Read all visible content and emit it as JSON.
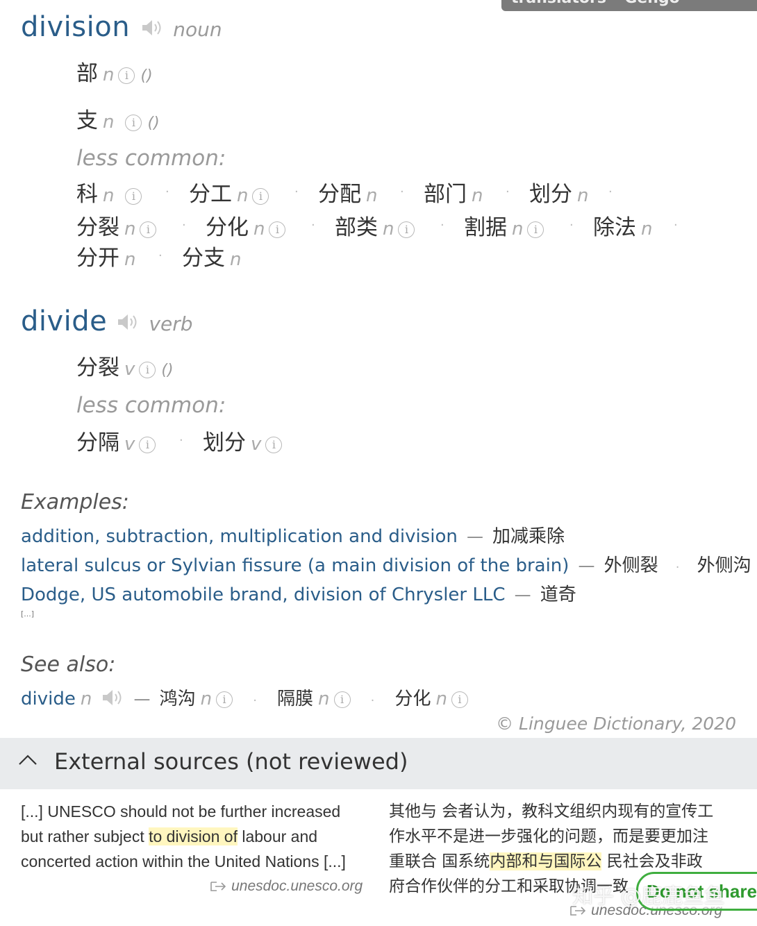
{
  "tooltip": {
    "text": "translators – Gengo"
  },
  "entries": [
    {
      "headword": "division",
      "pos": "noun",
      "main": [
        {
          "zh": "部",
          "g": "n",
          "paren": "()"
        },
        {
          "zh": "支",
          "g": "n",
          "paren": "()"
        }
      ],
      "less_common_label": "less common:",
      "less_common": [
        {
          "zh": "科",
          "g": "n"
        },
        {
          "zh": "分工",
          "g": "n"
        },
        {
          "zh": "分配",
          "g": "n"
        },
        {
          "zh": "部门",
          "g": "n"
        },
        {
          "zh": "划分",
          "g": "n"
        },
        {
          "zh": "分裂",
          "g": "n"
        },
        {
          "zh": "分化",
          "g": "n"
        },
        {
          "zh": "部类",
          "g": "n"
        },
        {
          "zh": "割据",
          "g": "n"
        },
        {
          "zh": "除法",
          "g": "n"
        },
        {
          "zh": "分开",
          "g": "n"
        },
        {
          "zh": "分支",
          "g": "n"
        }
      ]
    },
    {
      "headword": "divide",
      "pos": "verb",
      "main": [
        {
          "zh": "分裂",
          "g": "v",
          "paren": "()"
        }
      ],
      "less_common_label": "less common:",
      "less_common": [
        {
          "zh": "分隔",
          "g": "v"
        },
        {
          "zh": "划分",
          "g": "v"
        }
      ]
    }
  ],
  "examples": {
    "label": "Examples:",
    "items": [
      {
        "en": "addition, subtraction, multiplication and division",
        "zh": [
          "加减乘除"
        ]
      },
      {
        "en": "lateral sulcus or Sylvian fissure (a main division of the brain)",
        "zh": [
          "外侧裂",
          "外侧沟"
        ]
      },
      {
        "en": "Dodge, US automobile brand, division of Chrysler LLC",
        "zh": [
          "道奇"
        ]
      }
    ],
    "more": "[...]"
  },
  "see_also": {
    "label": "See also:",
    "term": "divide",
    "term_g": "n",
    "items": [
      {
        "zh": "鸿沟",
        "g": "n"
      },
      {
        "zh": "隔膜",
        "g": "n"
      },
      {
        "zh": "分化",
        "g": "n"
      }
    ]
  },
  "copyright": "© Linguee Dictionary, 2020",
  "external": {
    "title": "External sources (not reviewed)",
    "en_lines": [
      "[...] UNESCO should not be further increased",
      "but rather subject ",
      "to division of",
      " labour and",
      "concerted action within the United Nations [...]"
    ],
    "en_domain": "unesdoc.unesco.org",
    "zh_lines": [
      "其他与 会者认为，教科文组织内现有的宣传工",
      "作水平不是进一步强化的问题，而是要更加注",
      "重联合 国系统",
      "内部和与国际公",
      " 民社会及非政",
      "府合作伙伴的分工和采取协调一致"
    ],
    "zh_domain": "unesdoc.unesco.org"
  },
  "overlay": {
    "badge": "Do not share",
    "watermark": "知乎 @鹿鹿鱼鱼"
  }
}
